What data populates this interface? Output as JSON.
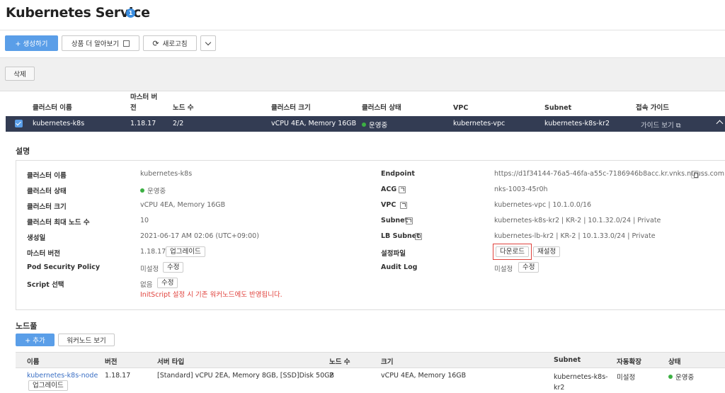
{
  "page": {
    "title": "Kubernetes Service",
    "badge": "1"
  },
  "toolbar": {
    "create_label": "+ 생성하기",
    "learn_label": "상품 더 알아보기",
    "refresh_label": "새로고침",
    "delete_label": "삭제"
  },
  "cluster_table": {
    "headers": {
      "name": "클러스터 이름",
      "master_version_1": "마스터 버",
      "master_version_2": "전",
      "nodes": "노드 수",
      "size": "클러스터 크기",
      "status": "클러스터 상태",
      "vpc": "VPC",
      "subnet": "Subnet",
      "guide": "접속 가이드"
    },
    "row": {
      "name": "kubernetes-k8s",
      "version": "1.18.17",
      "nodes": "2/2",
      "size": "vCPU 4EA, Memory 16GB",
      "status": "운영중",
      "vpc": "kubernetes-vpc",
      "subnet": "kubernetes-k8s-kr2",
      "guide": "가이드 보기"
    }
  },
  "detail": {
    "title": "설명",
    "left": {
      "name_label": "클러스터 이름",
      "name_value": "kubernetes-k8s",
      "status_label": "클러스터 상태",
      "status_value": "운영중",
      "size_label": "클러스터 크기",
      "size_value": "vCPU 4EA, Memory 16GB",
      "max_nodes_label": "클러스터 최대 노드 수",
      "max_nodes_value": "10",
      "created_label": "생성일",
      "created_value": "2021-06-17 AM 02:06 (UTC+09:00)",
      "master_label": "마스터 버전",
      "master_value": "1.18.17",
      "upgrade_label": "업그레이드",
      "psp_label": "Pod Security Policy",
      "psp_value": "미설정",
      "psp_edit": "수정",
      "script_label": "Script 선택",
      "script_value": "없음",
      "script_edit": "수정",
      "script_warning": "InitScript 설정 시 기존 워커노드에도 반영됩니다."
    },
    "right": {
      "endpoint_label": "Endpoint",
      "endpoint_value": "https://d1f34144-76a5-46fa-a55c-7186946b8acc.kr.vnks.ntruss.com",
      "acg_label": "ACG",
      "acg_value": "nks-1003-45r0h",
      "vpc_label": "VPC",
      "vpc_value": "kubernetes-vpc | 10.1.0.0/16",
      "subnet_label": "Subnet",
      "subnet_value": "kubernetes-k8s-kr2 | KR-2 | 10.1.32.0/24 | Private",
      "lb_label": "LB Subnet",
      "lb_value": "kubernetes-lb-kr2 | KR-2 | 10.1.33.0/24 | Private",
      "config_label": "설정파일",
      "download_label": "다운로드",
      "reset_label": "재설정",
      "audit_label": "Audit Log",
      "audit_value": "미설정",
      "audit_edit": "수정"
    }
  },
  "nodepool": {
    "title": "노드풀",
    "add_label": "+ 추가",
    "worker_label": "워커노드 보기",
    "headers": {
      "name": "이름",
      "version": "버전",
      "server_type": "서버 타입",
      "nodes": "노드 수",
      "size": "크기",
      "subnet": "Subnet",
      "autoscale": "자동확장",
      "status": "상태"
    },
    "row": {
      "name": "kubernetes-k8s-node",
      "upgrade": "업그레이드",
      "version": "1.18.17",
      "server_type": "[Standard] vCPU 2EA, Memory 8GB, [SSD]Disk 50GB",
      "nodes": "2",
      "size": "vCPU 4EA, Memory 16GB",
      "subnet_1": "kubernetes-k8s-",
      "subnet_2": "kr2",
      "autoscale": "미설정",
      "status": "운영중"
    }
  },
  "colors": {
    "primary": "#5a9ee8",
    "selected_row": "#333c53",
    "running": "#3cb043",
    "warning": "#e0423c"
  }
}
